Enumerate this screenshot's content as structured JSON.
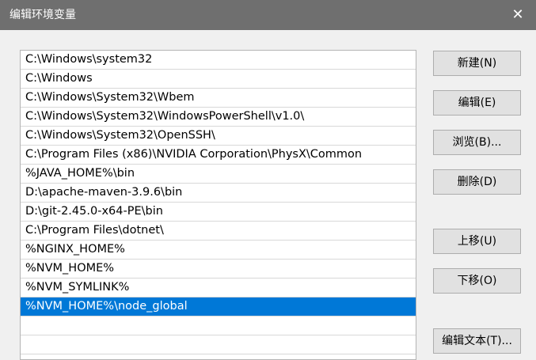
{
  "window": {
    "title": "编辑环境变量",
    "close_glyph": "✕"
  },
  "path_list": {
    "items": [
      "C:\\Windows\\system32",
      "C:\\Windows",
      "C:\\Windows\\System32\\Wbem",
      "C:\\Windows\\System32\\WindowsPowerShell\\v1.0\\",
      "C:\\Windows\\System32\\OpenSSH\\",
      "C:\\Program Files (x86)\\NVIDIA Corporation\\PhysX\\Common",
      "%JAVA_HOME%\\bin",
      "D:\\apache-maven-3.9.6\\bin",
      "D:\\git-2.45.0-x64-PE\\bin",
      "C:\\Program Files\\dotnet\\",
      "%NGINX_HOME%",
      "%NVM_HOME%",
      "%NVM_SYMLINK%",
      "%NVM_HOME%\\node_global"
    ],
    "selected_index": 13
  },
  "buttons": {
    "new": "新建(N)",
    "edit": "编辑(E)",
    "browse": "浏览(B)...",
    "delete": "删除(D)",
    "move_up": "上移(U)",
    "move_down": "下移(O)",
    "edit_text": "编辑文本(T)..."
  },
  "colors": {
    "titlebar": "#6f6f6f",
    "selection": "#0078d7",
    "background": "#f0f0f0"
  }
}
